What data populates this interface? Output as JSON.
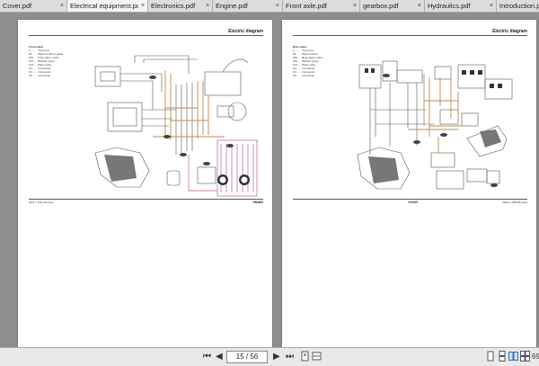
{
  "tabs": [
    {
      "label": "Cover.pdf",
      "active": false
    },
    {
      "label": "Electrical equipment.pdf",
      "active": true
    },
    {
      "label": "Electronics.pdf",
      "active": false
    },
    {
      "label": "Engine.pdf",
      "active": false
    },
    {
      "label": "Front axle.pdf",
      "active": false
    },
    {
      "label": "gearbox.pdf",
      "active": false
    },
    {
      "label": "Hydraulics.pdf",
      "active": false
    },
    {
      "label": "Introduction.pdf",
      "active": false
    }
  ],
  "close_glyph": "×",
  "page_left": {
    "header": "Electric diagram",
    "legend_title": "Front wiper",
    "legend": [
      "1 ......... Fuse box",
      "26 ...... Wiper control module",
      "163 .... Front wiper motor",
      "164 .... Washer pump",
      "213 .... Wiper relay",
      "C2 ...... Connector",
      "C3 ...... Connector",
      "C6 ...... Connector"
    ],
    "footer_left": "2013 © JCB Vibromax",
    "footer_right": "VM46D"
  },
  "page_right": {
    "header": "Electric diagram",
    "legend_title": "Rear wiper",
    "legend": [
      "1 ......... Fuse box",
      "26 ...... Wiper control",
      "165 .... Rear wiper motor",
      "166 .... Washer pump",
      "214 .... Wiper relay",
      "C2 ...... Connector",
      "C3 ...... Connector",
      "C6 ...... Connector"
    ],
    "footer_left": "VM46D",
    "footer_right": "2013 © JCB Vibromax"
  },
  "toolbar": {
    "first": "⏮",
    "prev": "◀",
    "page_value": "15 / 56",
    "next": "▶",
    "last": "⏭",
    "zoom": "69"
  },
  "icons": {
    "first": "first-page-icon",
    "prev": "prev-page-icon",
    "next": "next-page-icon",
    "last": "last-page-icon"
  }
}
